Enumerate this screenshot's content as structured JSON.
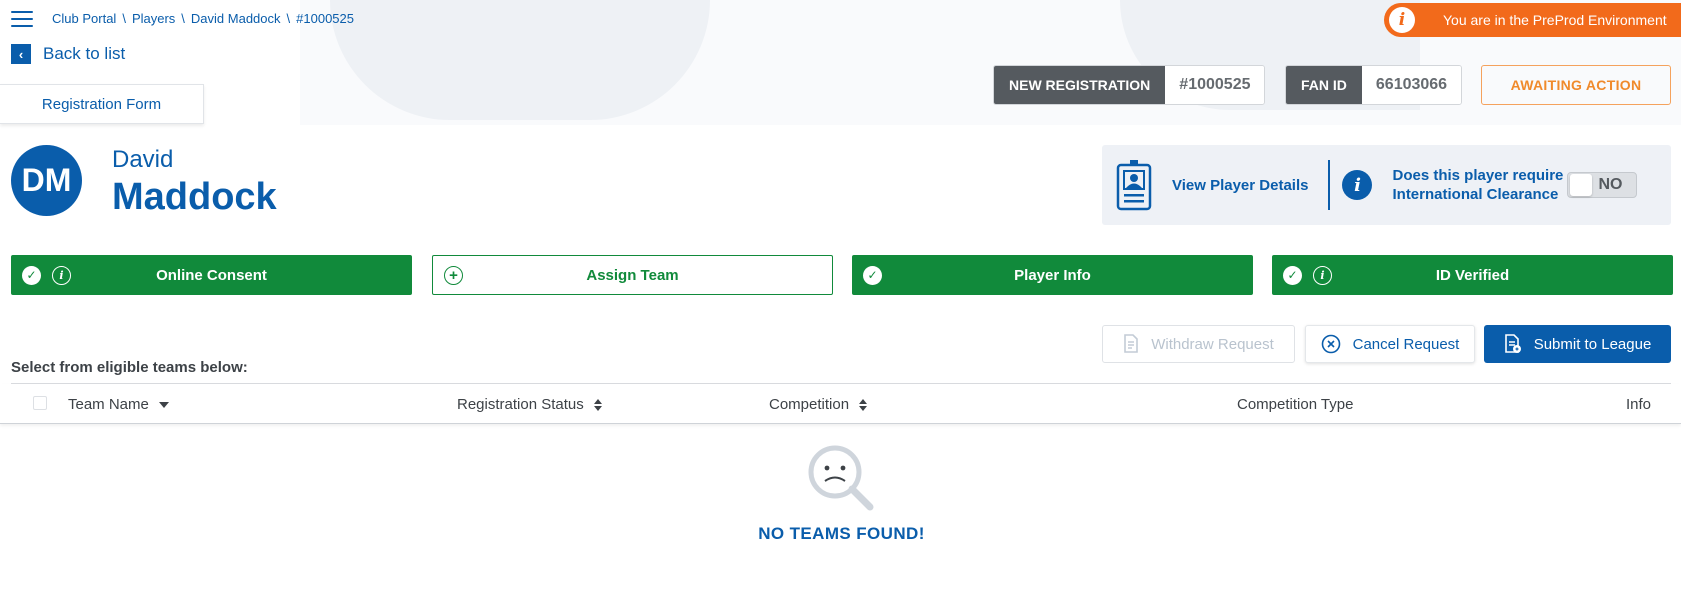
{
  "nav": {
    "breadcrumb": [
      "Club Portal",
      "Players",
      "David Maddock",
      "#1000525"
    ],
    "separator": "\\",
    "back_label": "Back to list",
    "form_tab": "Registration Form"
  },
  "environment": {
    "text": "You are in the PreProd Environment",
    "icon": "info-icon",
    "color": "#f26a1b"
  },
  "registration": {
    "type_label": "NEW REGISTRATION",
    "id": "#1000525",
    "fan_label": "FAN ID",
    "fan_id": "66103066",
    "status": "AWAITING ACTION"
  },
  "player": {
    "initials": "DM",
    "first_name": "David",
    "last_name": "Maddock",
    "view_details": "View Player Details",
    "clearance_question": "Does this player require International Clearance",
    "clearance_value": "NO"
  },
  "steps": [
    {
      "label": "Online Consent",
      "state": "complete",
      "has_info": true
    },
    {
      "label": "Assign Team",
      "state": "pending",
      "has_info": false
    },
    {
      "label": "Player Info",
      "state": "complete",
      "has_info": false
    },
    {
      "label": "ID Verified",
      "state": "complete",
      "has_info": true
    }
  ],
  "actions": {
    "withdraw": "Withdraw Request",
    "cancel": "Cancel Request",
    "submit": "Submit to League"
  },
  "teams": {
    "prompt": "Select from eligible teams below:",
    "columns": [
      "Team Name",
      "Registration Status",
      "Competition",
      "Competition Type",
      "Info"
    ],
    "empty_message": "NO TEAMS FOUND!"
  },
  "colors": {
    "primary": "#0a5dab",
    "success": "#118a3b",
    "warning": "#f08a2b",
    "dark": "#555a5f"
  }
}
